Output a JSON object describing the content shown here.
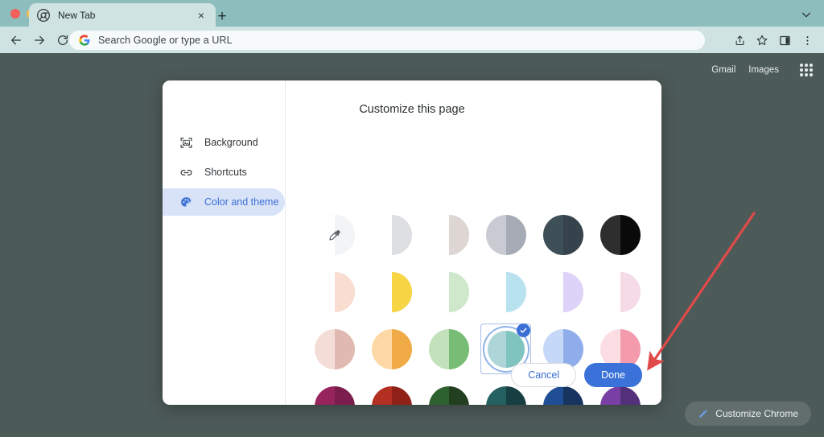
{
  "browser": {
    "tab": {
      "title": "New Tab",
      "favicon": "chrome-logo-icon",
      "close": "×"
    },
    "new_tab_button": "+",
    "tabstrip_chevron": "chevron-down-icon",
    "omnibox": {
      "placeholder": "Search Google or type a URL",
      "value": "",
      "leading_icon": "google-g-icon"
    },
    "nav": {
      "back": "back-arrow-icon",
      "forward": "forward-arrow-icon",
      "reload": "reload-icon"
    },
    "actions": {
      "share": "share-icon",
      "bookmark": "star-icon",
      "side_panel": "side-panel-icon",
      "menu": "three-dot-menu-icon"
    }
  },
  "ntp": {
    "links": [
      {
        "label": "Gmail",
        "name": "gmail-link"
      },
      {
        "label": "Images",
        "name": "images-link"
      }
    ],
    "apps_icon": "google-apps-grid-icon",
    "customize_chip": {
      "label": "Customize Chrome",
      "icon": "pencil-icon"
    }
  },
  "dialog": {
    "title": "Customize this page",
    "sidebar": [
      {
        "label": "Background",
        "icon": "image-frame-icon",
        "active": false
      },
      {
        "label": "Shortcuts",
        "icon": "link-icon",
        "active": false
      },
      {
        "label": "Color and theme",
        "icon": "palette-icon",
        "active": true
      }
    ],
    "swatches": [
      {
        "name": "custom-color-picker",
        "left": "#ffffff",
        "right": "#f3f4f5",
        "outlined": true,
        "eyedropper": true,
        "selected": false
      },
      {
        "name": "swatch-grey-light",
        "left": "#ffffff",
        "right": "#dedfe3",
        "outlined": true,
        "selected": false
      },
      {
        "name": "swatch-warm-grey",
        "left": "#ffffff",
        "right": "#ded6d3",
        "outlined": true,
        "selected": false
      },
      {
        "name": "swatch-cool-grey",
        "left": "#c9cbd3",
        "right": "#a7abb5",
        "outlined": false,
        "selected": false
      },
      {
        "name": "swatch-dark-slate",
        "left": "#3f4f58",
        "right": "#36434c",
        "outlined": false,
        "selected": false
      },
      {
        "name": "swatch-black",
        "left": "#2e2e2e",
        "right": "#0a0a0a",
        "outlined": false,
        "selected": false
      },
      {
        "name": "swatch-pale-peach",
        "left": "#ffffff",
        "right": "#f8ddd0",
        "outlined": true,
        "selected": false
      },
      {
        "name": "swatch-yellow",
        "left": "#ffffff",
        "right": "#f7d544",
        "outlined": true,
        "selected": false
      },
      {
        "name": "swatch-pale-green",
        "left": "#ffffff",
        "right": "#cfe8cb",
        "outlined": true,
        "selected": false
      },
      {
        "name": "swatch-pale-blue",
        "left": "#ffffff",
        "right": "#b9e2ef",
        "outlined": true,
        "selected": false
      },
      {
        "name": "swatch-pale-lavender",
        "left": "#ffffff",
        "right": "#ddd2f7",
        "outlined": true,
        "selected": false
      },
      {
        "name": "swatch-pale-pink",
        "left": "#ffffff",
        "right": "#f5dbe6",
        "outlined": true,
        "selected": false
      },
      {
        "name": "swatch-blush",
        "left": "#f4ddd7",
        "right": "#e0b9b0",
        "outlined": false,
        "selected": false
      },
      {
        "name": "swatch-orange",
        "left": "#fcd9a4",
        "right": "#f0ab47",
        "outlined": false,
        "selected": false
      },
      {
        "name": "swatch-green",
        "left": "#c3e2bb",
        "right": "#78bd76",
        "outlined": false,
        "selected": false
      },
      {
        "name": "swatch-teal",
        "left": "#aed6d9",
        "right": "#7fc4bf",
        "outlined": false,
        "selected": true
      },
      {
        "name": "swatch-periwinkle",
        "left": "#c6d8f8",
        "right": "#8fadea",
        "outlined": false,
        "selected": false
      },
      {
        "name": "swatch-pink",
        "left": "#fbdde3",
        "right": "#f39bad",
        "outlined": false,
        "selected": false
      },
      {
        "name": "swatch-berry",
        "left": "#97245c",
        "right": "#7c1e4d",
        "outlined": false,
        "selected": false
      },
      {
        "name": "swatch-brick-red",
        "left": "#b32f21",
        "right": "#8f2118",
        "outlined": false,
        "selected": false
      },
      {
        "name": "swatch-forest-green",
        "left": "#2d6130",
        "right": "#22401f",
        "outlined": false,
        "selected": false
      },
      {
        "name": "swatch-dark-teal",
        "left": "#246160",
        "right": "#173f41",
        "outlined": false,
        "selected": false
      },
      {
        "name": "swatch-navy",
        "left": "#1f4e95",
        "right": "#16345f",
        "outlined": false,
        "selected": false
      },
      {
        "name": "swatch-purple",
        "left": "#7a3fa5",
        "right": "#55307a",
        "outlined": false,
        "selected": false
      }
    ],
    "buttons": {
      "cancel": "Cancel",
      "done": "Done"
    }
  },
  "annotation": {
    "arrow_color": "#e04a4a"
  },
  "colors": {
    "tabstrip": "#8dbdbc",
    "toolbar": "#cfe3e2",
    "page_background": "#4c5a58",
    "accent_blue": "#3b72d9",
    "sidebar_active_bg": "#d9e3f8"
  }
}
